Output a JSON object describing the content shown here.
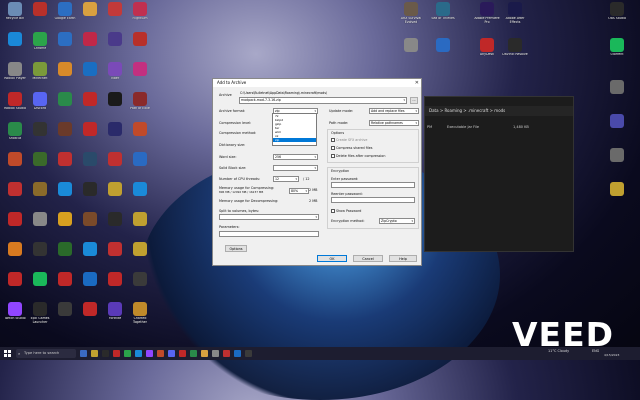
{
  "desktop": {
    "left_icons": [
      {
        "label": "Recycle Bin",
        "color": "#6b8cb5"
      },
      {
        "label": "",
        "color": "#b8302a"
      },
      {
        "label": "Google Earth",
        "color": "#2c6ec2"
      },
      {
        "label": "",
        "color": "#d8a040"
      },
      {
        "label": "",
        "color": "#c23a3a"
      },
      {
        "label": "FlightSim",
        "color": "#c03050"
      },
      {
        "label": "",
        "color": "#1a88d8"
      },
      {
        "label": "Chrome",
        "color": "#2ba44a"
      },
      {
        "label": "",
        "color": "#2c6ec2"
      },
      {
        "label": "",
        "color": "#c02848"
      },
      {
        "label": "",
        "color": "#4a3a8a"
      },
      {
        "label": "",
        "color": "#b8302a"
      },
      {
        "label": "Roblox Player",
        "color": "#888"
      },
      {
        "label": "Minecraft",
        "color": "#7a9a3a"
      },
      {
        "label": "",
        "color": "#d88a2a"
      },
      {
        "label": "",
        "color": "#1a6ec2"
      },
      {
        "label": "Viber",
        "color": "#7a4ab8"
      },
      {
        "label": "",
        "color": "#c23080"
      },
      {
        "label": "Roblox Studio",
        "color": "#c02828"
      },
      {
        "label": "Discord",
        "color": "#5865f2"
      },
      {
        "label": "",
        "color": "#2a8a4a"
      },
      {
        "label": "",
        "color": "#c02828"
      },
      {
        "label": "",
        "color": "#1a1a1a"
      },
      {
        "label": "Path of Exile",
        "color": "#8a2a2a"
      },
      {
        "label": "Shotcut",
        "color": "#2a8a4a"
      },
      {
        "label": "",
        "color": "#333"
      },
      {
        "label": "",
        "color": "#6a3a2a"
      },
      {
        "label": "",
        "color": "#c02828"
      },
      {
        "label": "",
        "color": "#2a2a6a"
      },
      {
        "label": "",
        "color": "#c04a2a"
      },
      {
        "label": "",
        "color": "#c04a2a"
      },
      {
        "label": "",
        "color": "#3a6a2a"
      },
      {
        "label": "",
        "color": "#c03030"
      },
      {
        "label": "",
        "color": "#2a4a6a"
      },
      {
        "label": "",
        "color": "#c03030"
      },
      {
        "label": "",
        "color": "#2a6ac2"
      },
      {
        "label": "",
        "color": "#c03030"
      },
      {
        "label": "",
        "color": "#8a6a2a"
      },
      {
        "label": "",
        "color": "#1a8ad8"
      },
      {
        "label": "",
        "color": "#2a2a2a"
      },
      {
        "label": "",
        "color": "#c0a030"
      },
      {
        "label": "",
        "color": "#1a8ad8"
      },
      {
        "label": "",
        "color": "#c02828"
      },
      {
        "label": "",
        "color": "#888"
      },
      {
        "label": "",
        "color": "#d8a020"
      },
      {
        "label": "",
        "color": "#7a4a2a"
      },
      {
        "label": "",
        "color": "#2a2a2a"
      },
      {
        "label": "",
        "color": "#c0a030"
      },
      {
        "label": "",
        "color": "#d87a20"
      },
      {
        "label": "",
        "color": "#333"
      },
      {
        "label": "",
        "color": "#2a6a2a"
      },
      {
        "label": "",
        "color": "#1a8ad8"
      },
      {
        "label": "",
        "color": "#c03030"
      },
      {
        "label": "",
        "color": "#c0a030"
      },
      {
        "label": "",
        "color": "#c02828"
      },
      {
        "label": "",
        "color": "#1ab85a"
      },
      {
        "label": "",
        "color": "#c02828"
      },
      {
        "label": "",
        "color": "#1a6ac2"
      },
      {
        "label": "",
        "color": "#c02828"
      },
      {
        "label": "",
        "color": "#3a3a3a"
      },
      {
        "label": "Twitch Studio",
        "color": "#9146ff"
      },
      {
        "label": "Epic Games Launcher",
        "color": "#2a2a2a"
      },
      {
        "label": "",
        "color": "#3a3a3a"
      },
      {
        "label": "",
        "color": "#c02828"
      },
      {
        "label": "Fortnite",
        "color": "#5a3ab8"
      },
      {
        "label": "Charted Together",
        "color": "#c08a2a"
      }
    ],
    "top_icons": [
      {
        "label": "ARX Survival Evolved",
        "color": "#6a5a4a"
      },
      {
        "label": "Sea of Thieves",
        "color": "#2a6a8a"
      },
      {
        "label": "Adobe Premiere Pro",
        "color": "#2a1a5a"
      },
      {
        "label": "Adobe After Effects",
        "color": "#1a1a4a"
      },
      {
        "label": "OBS Studio",
        "color": "#2a2a2a"
      }
    ],
    "top_icons_row2": [
      {
        "label": "",
        "color": "#888"
      },
      {
        "label": "",
        "color": "#2a6ac2"
      },
      {
        "label": "AnyDesk",
        "color": "#c02828"
      },
      {
        "label": "DaVinci Resolve",
        "color": "#2a2a2a"
      },
      {
        "label": "uTorrent",
        "color": "#1ab85a"
      }
    ],
    "right_icons": [
      {
        "label": "",
        "color": "#6a6a6a"
      },
      {
        "label": "",
        "color": "#4a4aaa"
      },
      {
        "label": "",
        "color": "#6a6a6a"
      },
      {
        "label": "",
        "color": "#c0a030"
      }
    ]
  },
  "explorer": {
    "breadcrumb": "Data  >  Roaming  >  .minecraft  >  mods",
    "file_type": "Executable Jar File",
    "file_size": "1,480 KB"
  },
  "dialog": {
    "title": "Add to Archive",
    "archive_label": "Archive",
    "archive_path": "C:\\Users\\Bulletnet\\AppData\\Roaming\\.minecraft\\mods\\",
    "archive_name": "modpack-mod-7.3.16.zip",
    "browse": "...",
    "format_label": "Archive format:",
    "format_value": "zip",
    "format_options": [
      "7z",
      "bzip2",
      "gzip",
      "tar",
      "wim",
      "xz",
      "zip"
    ],
    "level_label": "Compression level:",
    "method_label": "Compression method:",
    "dict_label": "Dictionary size:",
    "word_label": "Word size:",
    "word_value": "256",
    "solid_label": "Solid Block size:",
    "threads_label": "Number of CPU threads:",
    "threads_value": "12",
    "threads_of": "/ 12",
    "mem_comp_label": "Memory usage for Compressing:",
    "mem_comp_sub": "896 MB / 12992 MB / 16237 MB",
    "mem_comp_value": "80%",
    "mem_comp_mb": "2 MB",
    "mem_decomp_label": "Memory usage for Decompressing:",
    "mem_decomp_value": "2 MB",
    "split_label": "Split to volumes, bytes:",
    "params_label": "Parameters:",
    "options_btn": "Options",
    "update_label": "Update mode:",
    "update_value": "Add and replace files",
    "path_label": "Path mode:",
    "path_value": "Relative pathnames",
    "options_group": "Options",
    "sfx": "Create SFX archive",
    "shared": "Compress shared files",
    "delete_after": "Delete files after compression",
    "enc_group": "Encryption",
    "enter_pw": "Enter password:",
    "reenter_pw": "Reenter password:",
    "show_pw": "Show Password",
    "enc_method_label": "Encryption method:",
    "enc_method_value": "ZipCrypto",
    "ok": "OK",
    "cancel": "Cancel",
    "help": "Help"
  },
  "taskbar": {
    "search_placeholder": "Type here to search",
    "weather": "11°C  Cloudy",
    "lang": "ENG",
    "time": "",
    "date": "4/15/2023"
  },
  "watermark": "VEED"
}
